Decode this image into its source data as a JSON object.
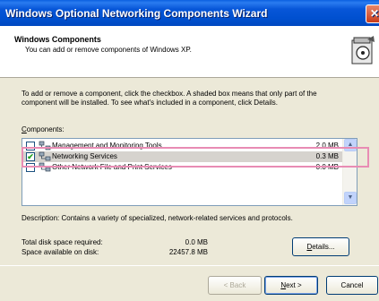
{
  "window": {
    "title": "Windows Optional Networking Components Wizard"
  },
  "header": {
    "title": "Windows Components",
    "subtitle": "You can add or remove components of Windows XP."
  },
  "instructions": "To add or remove a component, click the checkbox. A shaded box means that only part of the component will be installed. To see what's included in a component, click Details.",
  "components_label": {
    "accel": "C",
    "rest": "omponents:"
  },
  "components": [
    {
      "name": "Management and Monitoring Tools",
      "size": "2.0 MB",
      "checked": false
    },
    {
      "name": "Networking Services",
      "size": "0.3 MB",
      "checked": true
    },
    {
      "name": "Other Network File and Print Services",
      "size": "0.0 MB",
      "checked": false
    }
  ],
  "description": "Description:  Contains a variety of specialized, network-related services and protocols.",
  "disk": {
    "required_label": "Total disk space required:",
    "available_label": "Space available on disk:",
    "required_value": "0.0 MB",
    "available_value": "22457.8 MB"
  },
  "buttons": {
    "details_accel": "D",
    "details_rest": "etails...",
    "back": "< Back",
    "next_accel": "N",
    "next_rest": "ext >",
    "cancel": "Cancel"
  },
  "colors": {
    "titlebar": "#0050d0",
    "highlight_annotation": "#e88cb4",
    "checkmark": "#21a121"
  }
}
